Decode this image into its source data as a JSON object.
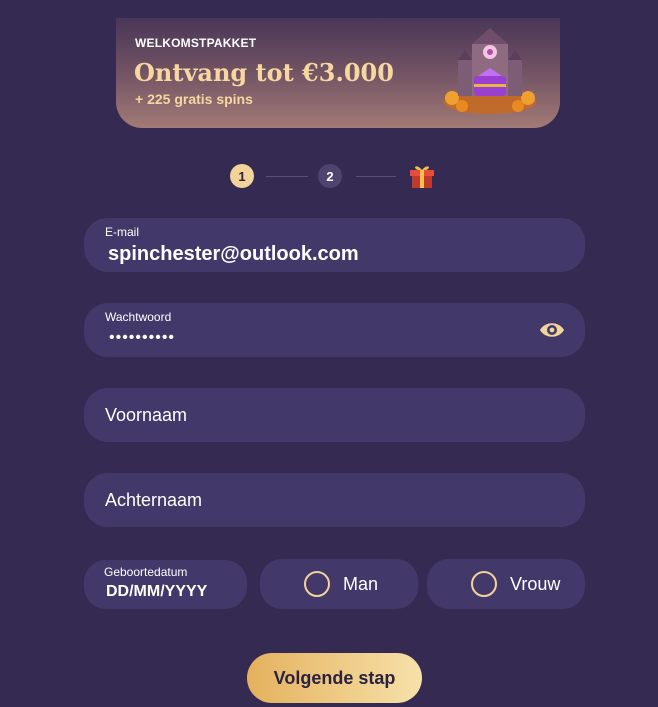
{
  "banner": {
    "kicker": "WELKOMSTPAKKET",
    "title": "Ontvang tot €3.000",
    "subtitle": "+ 225 gratis spins",
    "art_icon": "castle-chest-illustration"
  },
  "stepper": {
    "steps": [
      "1",
      "2"
    ],
    "final_icon": "gift-icon",
    "active_step": 1
  },
  "form": {
    "email": {
      "label": "E-mail",
      "value": "spinchester@outlook.com"
    },
    "password": {
      "label": "Wachtwoord",
      "value": "••••••••••",
      "toggle_icon": "eye-icon"
    },
    "first_name": {
      "placeholder": "Voornaam"
    },
    "last_name": {
      "placeholder": "Achternaam"
    },
    "birthdate": {
      "label": "Geboortedatum",
      "value": "DD/MM/YYYY"
    },
    "gender": {
      "options": [
        "Man",
        "Vrouw"
      ]
    }
  },
  "actions": {
    "next_label": "Volgende stap"
  },
  "colors": {
    "background": "#352b52",
    "field": "#43386a",
    "accent_gold": "#f2d39a",
    "button_gradient_start": "#e4b15d",
    "button_gradient_end": "#f7e1a9"
  }
}
